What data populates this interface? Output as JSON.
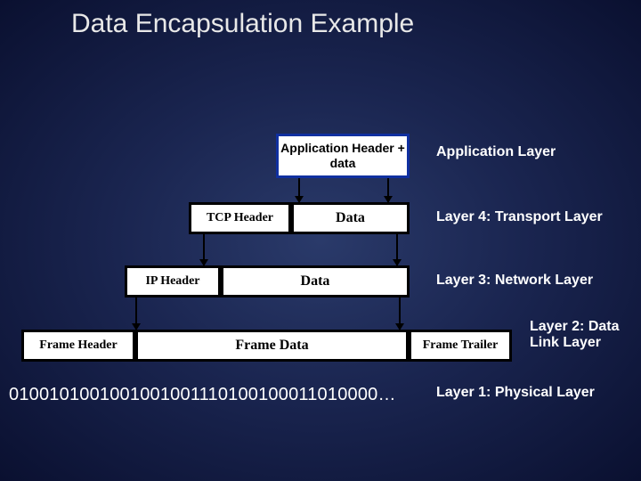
{
  "title": "Data Encapsulation Example",
  "layers": {
    "app": {
      "box": "Application Header + data",
      "label": "Application Layer"
    },
    "transport": {
      "header": "TCP Header",
      "data": "Data",
      "label": "Layer 4: Transport Layer"
    },
    "network": {
      "header": "IP Header",
      "data": "Data",
      "label": "Layer 3: Network Layer"
    },
    "datalink": {
      "header": "Frame Header",
      "data": "Frame Data",
      "trailer": "Frame Trailer",
      "label": "Layer 2: Data Link Layer"
    },
    "physical": {
      "bits": "0100101001001001001110100100011010000…",
      "label": "Layer 1: Physical Layer"
    }
  }
}
